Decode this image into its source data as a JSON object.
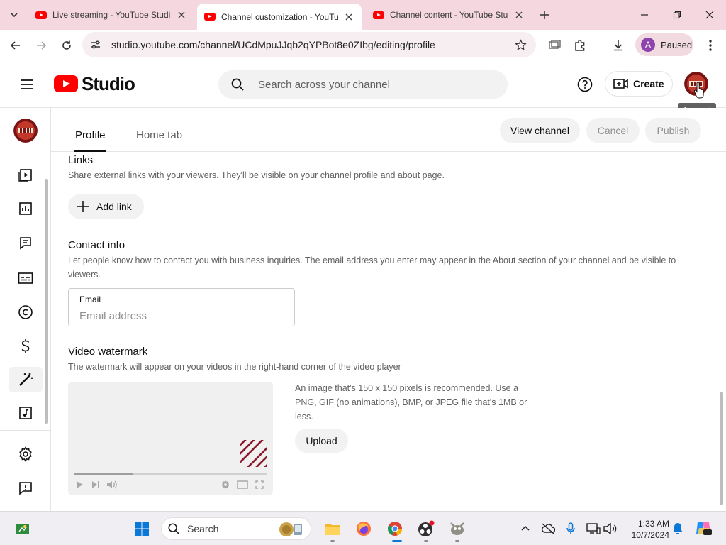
{
  "browser": {
    "tabs": [
      {
        "title": "Live streaming - YouTube Studi",
        "active": false
      },
      {
        "title": "Channel customization - YouTu",
        "active": true
      },
      {
        "title": "Channel content - YouTube Stu",
        "active": false
      }
    ],
    "url": "studio.youtube.com/channel/UCdMpuJJqb2qYPBot8e0ZIbg/editing/profile",
    "profile_initial": "A",
    "profile_status": "Paused"
  },
  "studio": {
    "logo_text": "Studio",
    "search_placeholder": "Search across your channel",
    "create_label": "Create",
    "account_tooltip": "Account"
  },
  "page": {
    "tabs": [
      "Profile",
      "Home tab"
    ],
    "actions": {
      "view_channel": "View channel",
      "cancel": "Cancel",
      "publish": "Publish"
    }
  },
  "links": {
    "title": "Links",
    "description": "Share external links with your viewers. They'll be visible on your channel profile and about page.",
    "add_link": "Add link"
  },
  "contact": {
    "title": "Contact info",
    "description": "Let people know how to contact you with business inquiries. The email address you enter may appear in the About section of your channel and be visible to viewers.",
    "email_label": "Email",
    "email_placeholder": "Email address",
    "email_value": ""
  },
  "watermark": {
    "title": "Video watermark",
    "description": "The watermark will appear on your videos in the right-hand corner of the video player",
    "help": "An image that's 150 x 150 pixels is recommended. Use a PNG, GIF (no animations), BMP, or JPEG file that's 1MB or less.",
    "upload": "Upload",
    "preview_progress": 0.3
  },
  "taskbar": {
    "search_label": "Search",
    "time": "1:33 AM",
    "date": "10/7/2024"
  },
  "colors": {
    "brand_red": "#ff0000",
    "tab_strip": "#f4d7df",
    "watermark_stripe": "#8b1a2b"
  }
}
